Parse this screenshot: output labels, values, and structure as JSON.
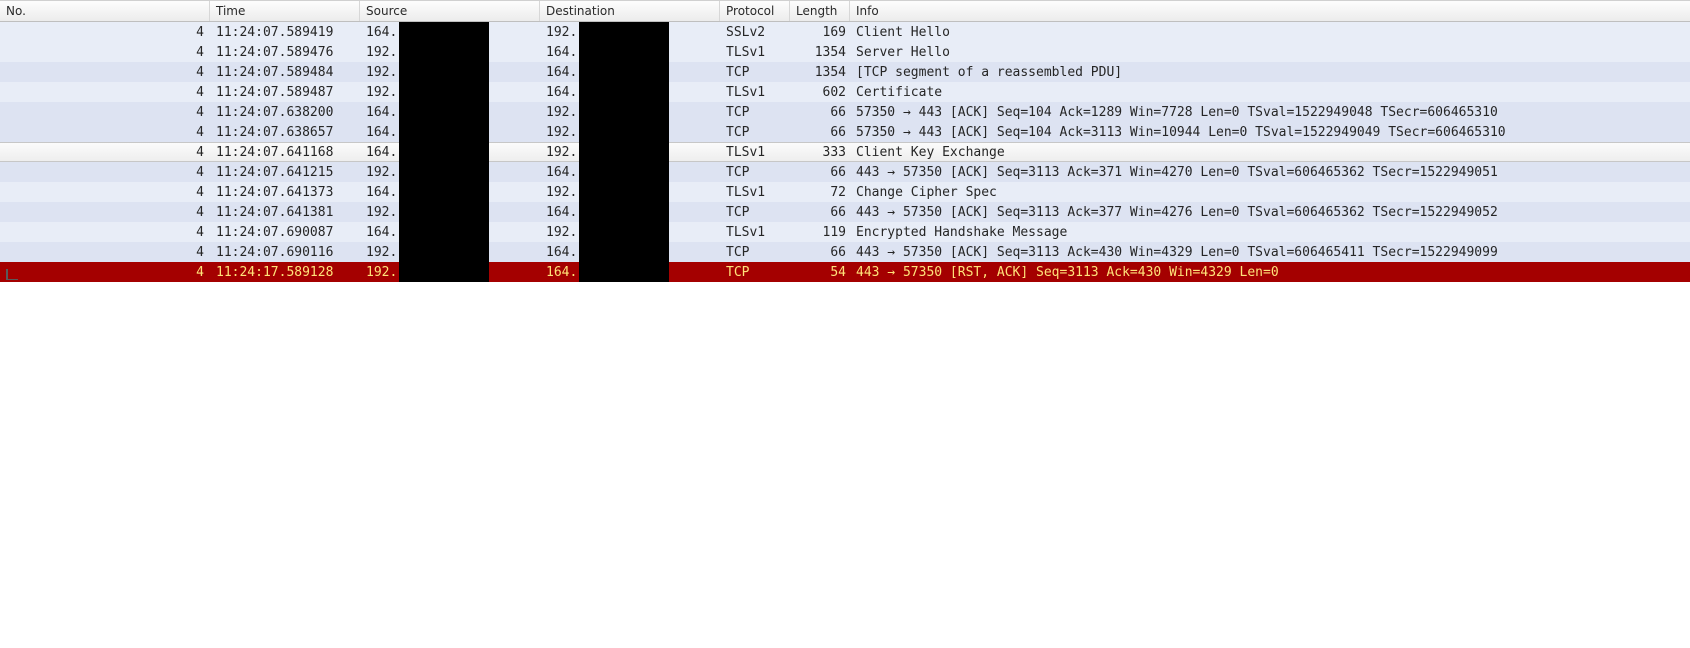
{
  "columns": {
    "no": "No.",
    "time": "Time",
    "source": "Source",
    "destination": "Destination",
    "protocol": "Protocol",
    "length": "Length",
    "info": "Info"
  },
  "rows": [
    {
      "no": "4",
      "time": "11:24:07.589419",
      "src": "164.",
      "dst": "192.",
      "proto": "SSLv2",
      "len": "169",
      "info": "Client Hello",
      "tint": "a"
    },
    {
      "no": "4",
      "time": "11:24:07.589476",
      "src": "192.",
      "dst": "164.",
      "proto": "TLSv1",
      "len": "1354",
      "info": "Server Hello",
      "tint": "a"
    },
    {
      "no": "4",
      "time": "11:24:07.589484",
      "src": "192.",
      "dst": "164.",
      "proto": "TCP",
      "len": "1354",
      "info": "[TCP segment of a reassembled PDU]",
      "tint": "b"
    },
    {
      "no": "4",
      "time": "11:24:07.589487",
      "src": "192.",
      "dst": "164.",
      "proto": "TLSv1",
      "len": "602",
      "info": "Certificate",
      "tint": "a"
    },
    {
      "no": "4",
      "time": "11:24:07.638200",
      "src": "164.",
      "dst": "192.",
      "proto": "TCP",
      "len": "66",
      "info": "57350 → 443 [ACK] Seq=104 Ack=1289 Win=7728 Len=0 TSval=1522949048 TSecr=606465310",
      "tint": "b"
    },
    {
      "no": "4",
      "time": "11:24:07.638657",
      "src": "164.",
      "dst": "192.",
      "proto": "TCP",
      "len": "66",
      "info": "57350 → 443 [ACK] Seq=104 Ack=3113 Win=10944 Len=0 TSval=1522949049 TSecr=606465310",
      "tint": "b"
    },
    {
      "no": "4",
      "time": "11:24:07.641168",
      "src": "164.",
      "dst": "192.",
      "proto": "TLSv1",
      "len": "333",
      "info": "Client Key Exchange",
      "tint": "sel"
    },
    {
      "no": "4",
      "time": "11:24:07.641215",
      "src": "192.",
      "dst": "164.",
      "proto": "TCP",
      "len": "66",
      "info": "443 → 57350 [ACK] Seq=3113 Ack=371 Win=4270 Len=0 TSval=606465362 TSecr=1522949051",
      "tint": "b"
    },
    {
      "no": "4",
      "time": "11:24:07.641373",
      "src": "164.",
      "dst": "192.",
      "proto": "TLSv1",
      "len": "72",
      "info": "Change Cipher Spec",
      "tint": "a"
    },
    {
      "no": "4",
      "time": "11:24:07.641381",
      "src": "192.",
      "dst": "164.",
      "proto": "TCP",
      "len": "66",
      "info": "443 → 57350 [ACK] Seq=3113 Ack=377 Win=4276 Len=0 TSval=606465362 TSecr=1522949052",
      "tint": "b"
    },
    {
      "no": "4",
      "time": "11:24:07.690087",
      "src": "164.",
      "dst": "192.",
      "proto": "TLSv1",
      "len": "119",
      "info": "Encrypted Handshake Message",
      "tint": "a"
    },
    {
      "no": "4",
      "time": "11:24:07.690116",
      "src": "192.",
      "dst": "164.",
      "proto": "TCP",
      "len": "66",
      "info": "443 → 57350 [ACK] Seq=3113 Ack=430 Win=4329 Len=0 TSval=606465411 TSecr=1522949099",
      "tint": "b"
    },
    {
      "no": "4",
      "time": "11:24:17.589128",
      "src": "192.",
      "dst": "164.",
      "proto": "TCP",
      "len": "54",
      "info": "443 → 57350 [RST, ACK] Seq=3113 Ack=430 Win=4329 Len=0",
      "tint": "rst",
      "mark": true
    }
  ]
}
